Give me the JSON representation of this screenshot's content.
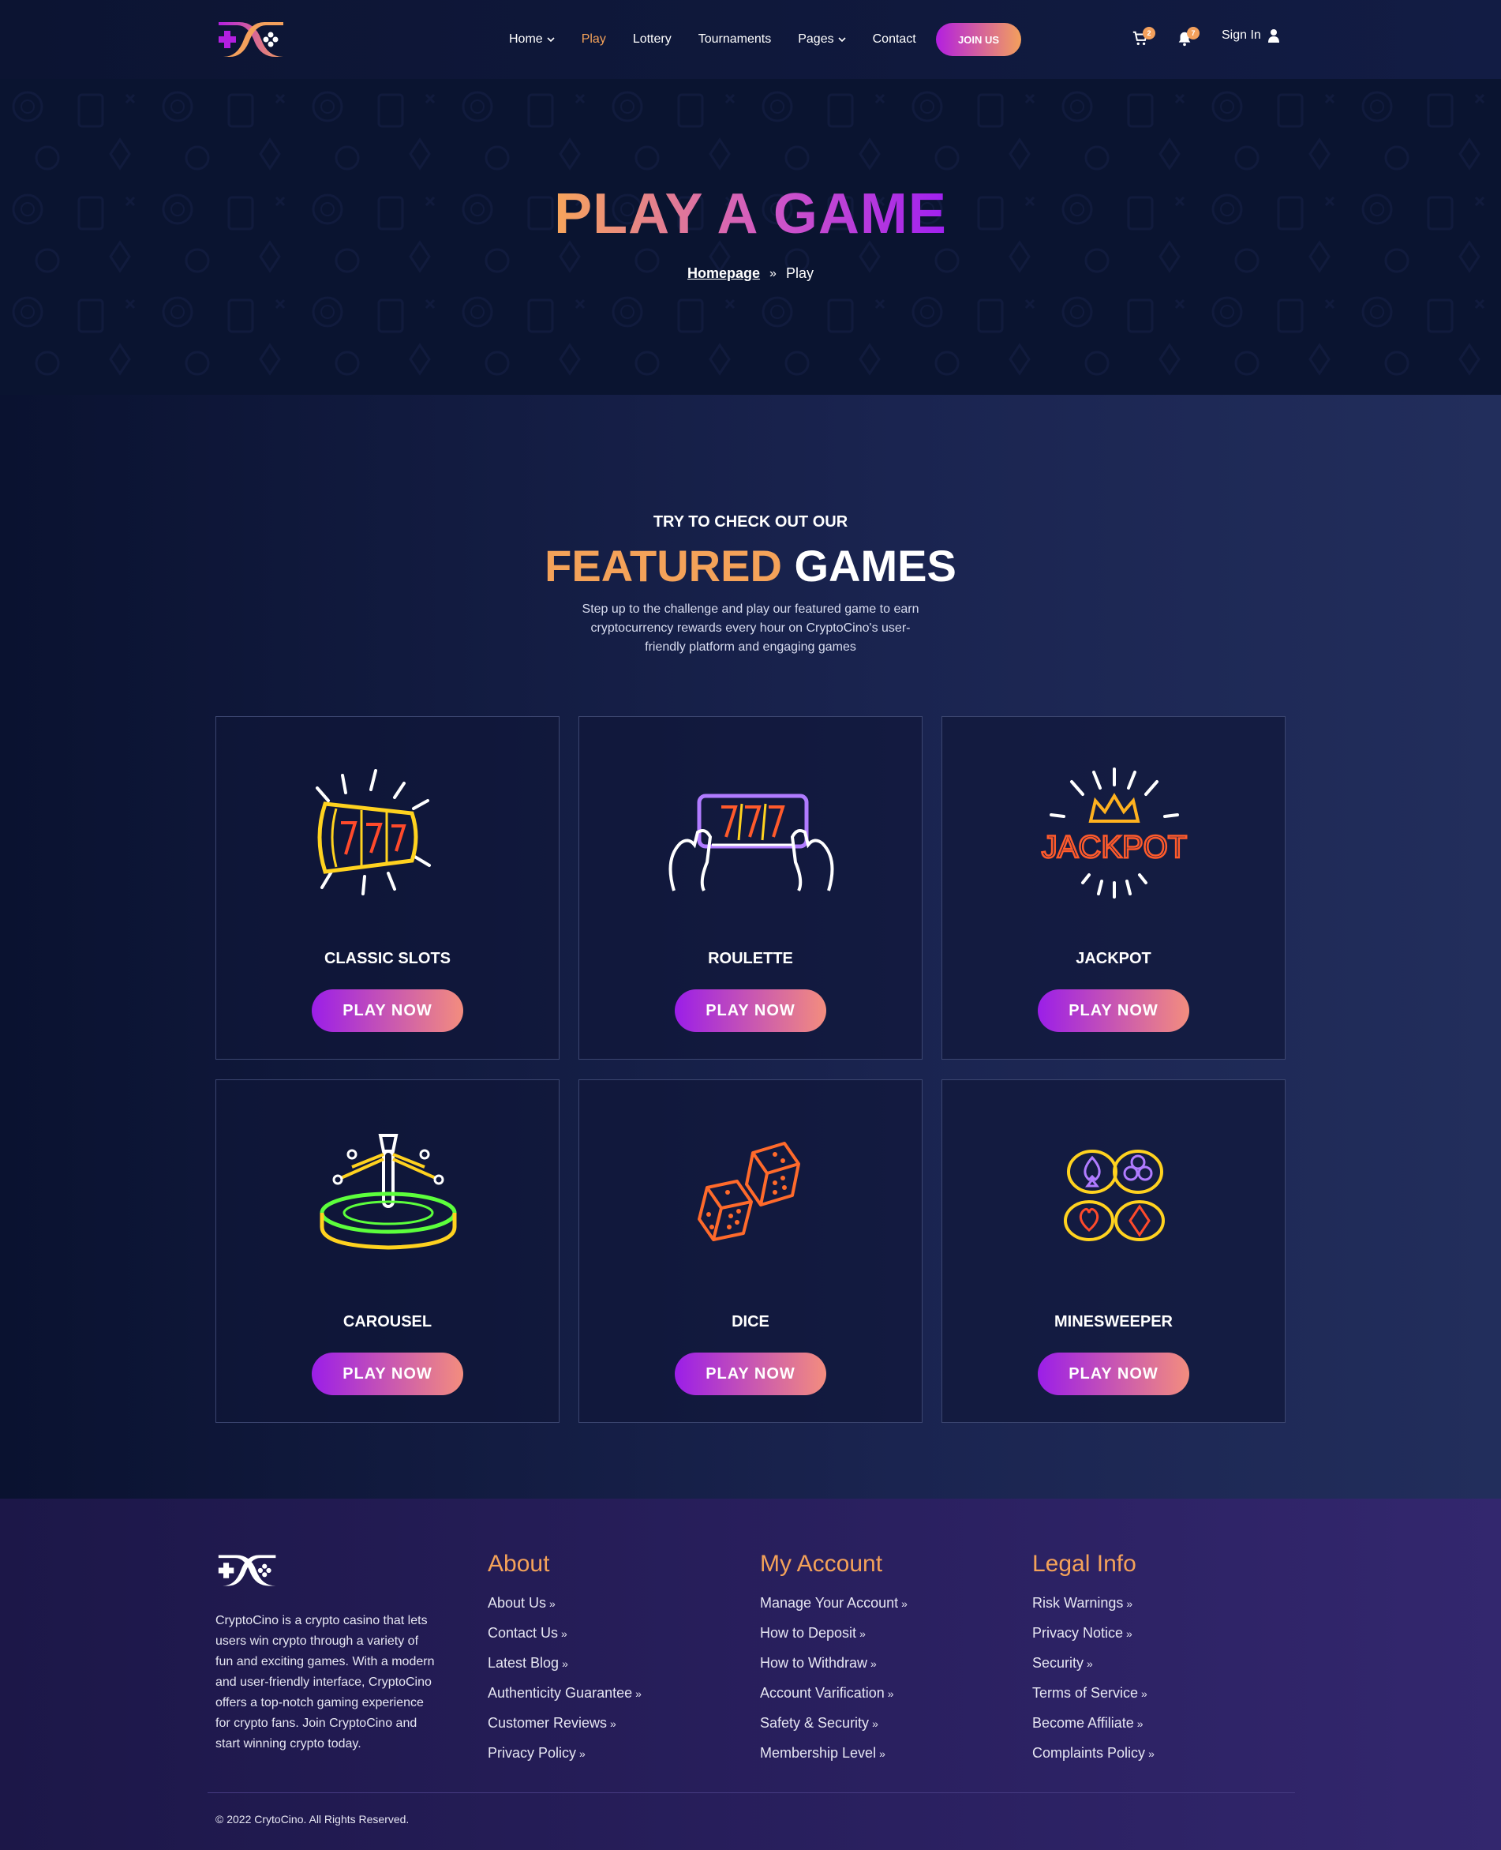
{
  "header": {
    "nav": [
      {
        "label": "Home",
        "dropdown": true,
        "active": false
      },
      {
        "label": "Play",
        "dropdown": false,
        "active": true
      },
      {
        "label": "Lottery",
        "dropdown": false,
        "active": false
      },
      {
        "label": "Tournaments",
        "dropdown": false,
        "active": false
      },
      {
        "label": "Pages",
        "dropdown": true,
        "active": false
      },
      {
        "label": "Contact",
        "dropdown": false,
        "active": false
      }
    ],
    "join_label": "JOIN US",
    "cart_count": "2",
    "notif_count": "7",
    "signin_label": "Sign In"
  },
  "hero": {
    "title": "PLAY A GAME",
    "breadcrumb_home": "Homepage",
    "breadcrumb_current": "Play"
  },
  "featured": {
    "eyebrow": "TRY TO CHECK OUT OUR",
    "title_part1": "FEATURED",
    "title_part2": "GAMES",
    "description": "Step up to the challenge and play our featured game to earn cryptocurrency rewards every hour on CryptoCino's user-friendly platform and engaging games",
    "play_label": "PLAY NOW",
    "games": [
      {
        "title": "CLASSIC SLOTS",
        "icon": "slot-reels-icon"
      },
      {
        "title": "ROULETTE",
        "icon": "slot-phone-icon"
      },
      {
        "title": "JACKPOT",
        "icon": "jackpot-crown-icon"
      },
      {
        "title": "CAROUSEL",
        "icon": "roulette-wheel-icon"
      },
      {
        "title": "DICE",
        "icon": "dice-icon"
      },
      {
        "title": "MINESWEEPER",
        "icon": "card-suit-chips-icon"
      }
    ]
  },
  "footer": {
    "about_text": "CryptoCino is a crypto casino that lets users win crypto through a variety of fun and exciting games. With a modern and user-friendly interface, CryptoCino offers a top-notch gaming experience for crypto fans. Join CryptoCino and start winning crypto today.",
    "columns": [
      {
        "title": "About",
        "links": [
          "About Us",
          "Contact Us",
          "Latest Blog",
          "Authenticity Guarantee",
          "Customer Reviews",
          "Privacy Policy"
        ]
      },
      {
        "title": "My Account",
        "links": [
          "Manage Your Account",
          "How to Deposit",
          "How to Withdraw",
          "Account Varification",
          "Safety & Security",
          "Membership Level"
        ]
      },
      {
        "title": "Legal Info",
        "links": [
          "Risk Warnings",
          "Privacy Notice",
          "Security",
          "Terms of Service",
          "Become Affiliate",
          "Complaints Policy"
        ]
      }
    ],
    "copyright": "© 2022 CrytoCino. All Rights Reserved."
  },
  "colors": {
    "accent_orange": "#f4a259",
    "accent_purple": "#9b1ee8",
    "bg_dark": "#0b1330",
    "footer_bg": "#2a2060"
  }
}
